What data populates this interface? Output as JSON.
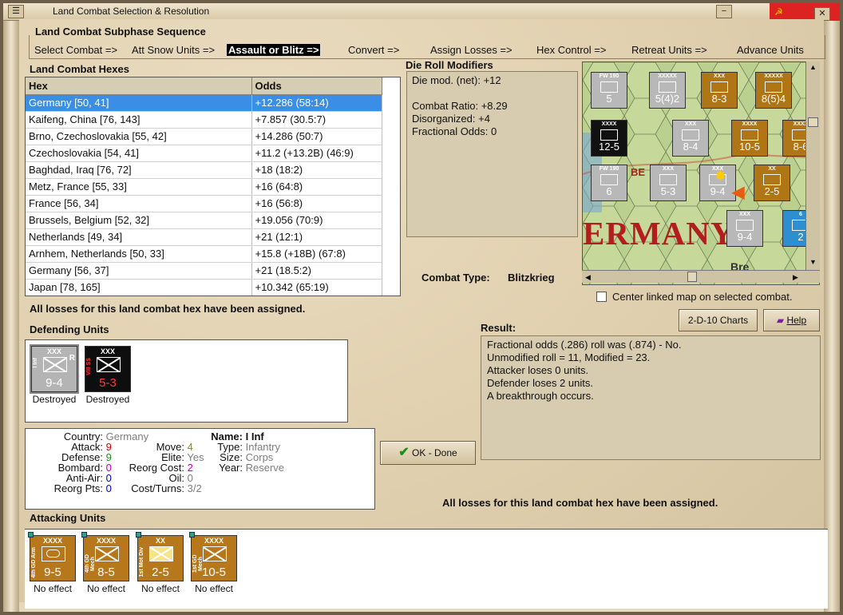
{
  "window": {
    "title": "Land Combat Selection & Resolution",
    "sys_menu_label": "☰",
    "min_label": "−",
    "close_label": "✕"
  },
  "subphase": {
    "title": "Land Combat Subphase Sequence",
    "steps": [
      {
        "label": "Select Combat =>",
        "active": false
      },
      {
        "label": "Att Snow Units =>",
        "active": false
      },
      {
        "label": "Assault or Blitz =>",
        "active": true
      },
      {
        "label": "Convert =>",
        "active": false
      },
      {
        "label": "Assign Losses =>",
        "active": false
      },
      {
        "label": "Hex Control =>",
        "active": false
      },
      {
        "label": "Retreat Units =>",
        "active": false
      },
      {
        "label": "Advance Units",
        "active": false
      }
    ]
  },
  "hexes": {
    "title": "Land Combat Hexes",
    "columns": [
      "Hex",
      "Odds"
    ],
    "rows": [
      {
        "hex": "Germany [50, 41]",
        "odds": "+12.286 (58:14)",
        "selected": true
      },
      {
        "hex": "Kaifeng, China [76, 143]",
        "odds": "+7.857 (30.5:7)"
      },
      {
        "hex": "Brno, Czechoslovakia [55, 42]",
        "odds": "+14.286 (50:7)"
      },
      {
        "hex": "Czechoslovakia [54, 41]",
        "odds": "+11.2 (+13.2B) (46:9)"
      },
      {
        "hex": "Baghdad, Iraq [76, 72]",
        "odds": "+18 (18:2)"
      },
      {
        "hex": "Metz, France [55, 33]",
        "odds": "+16 (64:8)"
      },
      {
        "hex": "France [56, 34]",
        "odds": "+16 (56:8)"
      },
      {
        "hex": "Brussels, Belgium [52, 32]",
        "odds": "+19.056 (70:9)"
      },
      {
        "hex": "Netherlands [49, 34]",
        "odds": "+21 (12:1)"
      },
      {
        "hex": "Arnhem, Netherlands [50, 33]",
        "odds": "+15.8 (+18B) (67:8)"
      },
      {
        "hex": "Germany [56, 37]",
        "odds": "+21 (18.5:2)"
      },
      {
        "hex": "Japan [78, 165]",
        "odds": "+10.342 (65:19)"
      }
    ],
    "losses_msg": "All losses for this land combat hex have been assigned."
  },
  "drm": {
    "title": "Die Roll Modifiers",
    "lines": [
      "Die mod. (net): +12",
      "",
      "Combat Ratio: +8.29",
      "Disorganized: +4",
      "Fractional Odds: 0"
    ]
  },
  "map": {
    "label": "ERMANY",
    "city_label": "Bre",
    "city2_label": "BE",
    "center_checkbox": "Center linked map on selected combat.",
    "counters": [
      {
        "top": "FW 190",
        "mid": "",
        "stats": "5",
        "cls": "gray"
      },
      {
        "top": "XXXXX",
        "stats": "5(4)2",
        "cls": "gray"
      },
      {
        "top": "XXX",
        "stats": "8-3",
        "cls": "brown"
      },
      {
        "top": "XXXXX",
        "stats": "8(5)4",
        "cls": "brown"
      },
      {
        "top": "XXXX",
        "stats": "12-5",
        "cls": "black"
      },
      {
        "top": "XXX",
        "stats": "8-4",
        "cls": "gray"
      },
      {
        "top": "XXXX",
        "stats": "10-5",
        "cls": "brown"
      },
      {
        "top": "XXXX",
        "stats": "8-6",
        "cls": "brown"
      },
      {
        "top": "FW 190",
        "stats": "6",
        "cls": "gray"
      },
      {
        "top": "XXX",
        "stats": "5-3",
        "cls": "gray"
      },
      {
        "top": "XXX",
        "stats": "9-4",
        "cls": "gray"
      },
      {
        "top": "XX",
        "stats": "2-5",
        "cls": "brown"
      },
      {
        "top": "XXX",
        "stats": "9-4",
        "cls": "gray"
      },
      {
        "top": "6",
        "stats": "2",
        "cls": "blue"
      }
    ]
  },
  "combat": {
    "type_label": "Combat Type:",
    "type_value": "Blitzkrieg"
  },
  "buttons": {
    "charts": "2-D-10 Charts",
    "help": "Help",
    "ok": "OK - Done"
  },
  "defending": {
    "title": "Defending Units",
    "units": [
      {
        "str": "9-4",
        "size": "XXX",
        "side": "I Inf",
        "status": "Destroyed",
        "mark": "R",
        "cls": "gray"
      },
      {
        "str": "5-3",
        "size": "XXX",
        "side": "VIII SS",
        "status": "Destroyed",
        "mark": "",
        "cls": "black"
      }
    ]
  },
  "details": {
    "country_label": "Country:",
    "country": "Germany",
    "attack_label": "Attack:",
    "attack": "9",
    "defense_label": "Defense:",
    "defense": "9",
    "bombard_label": "Bombard:",
    "bombard": "0",
    "antiair_label": "Anti-Air:",
    "antiair": "0",
    "reorg_pts_label": "Reorg Pts:",
    "reorg_pts": "0",
    "move_label": "Move:",
    "move": "4",
    "elite_label": "Elite:",
    "elite": "Yes",
    "reorg_cost_label": "Reorg Cost:",
    "reorg_cost": "2",
    "oil_label": "Oil:",
    "oil": "0",
    "cost_turns_label": "Cost/Turns:",
    "cost_turns": "3/2",
    "name_label": "Name:",
    "name": "I Inf",
    "type_label": "Type:",
    "type": "Infantry",
    "size_label": "Size:",
    "size": "Corps",
    "year_label": "Year:",
    "year": "Reserve"
  },
  "result": {
    "title": "Result:",
    "lines": [
      "Fractional odds (.286) roll was (.874)  - No.",
      "Unmodified roll = 11, Modified = 23.",
      "Attacker loses 0 units.",
      "Defender loses 2 units.",
      "A breakthrough occurs."
    ],
    "losses_msg": "All losses for this land combat hex have been assigned."
  },
  "attacking": {
    "title": "Attacking Units",
    "units": [
      {
        "str": "9-5",
        "size": "XXXX",
        "side": "4th GD Arm",
        "status": "No effect",
        "sym": "arm"
      },
      {
        "str": "8-5",
        "size": "XXXX",
        "side": "4th GD Mech",
        "status": "No effect",
        "sym": "mech"
      },
      {
        "str": "2-5",
        "size": "XX",
        "side": "1st Mot Div",
        "status": "No effect",
        "sym": "mot"
      },
      {
        "str": "10-5",
        "size": "XXXX",
        "side": "1st GD Mech",
        "status": "No effect",
        "sym": "mech"
      }
    ]
  }
}
